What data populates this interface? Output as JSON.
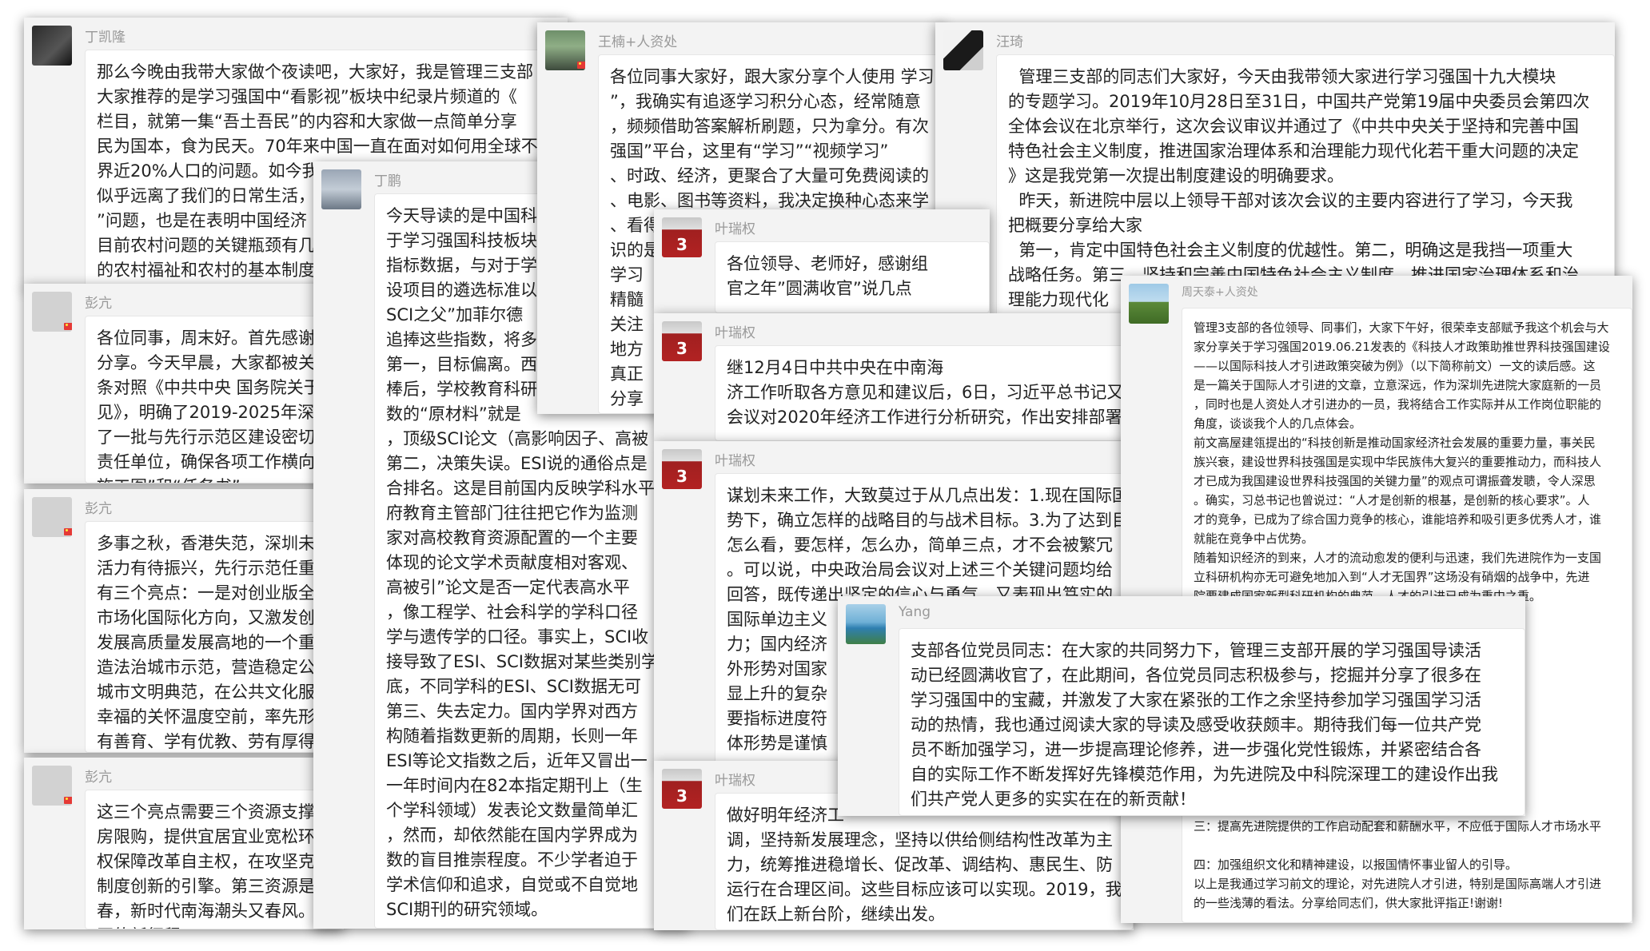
{
  "cards": [
    {
      "nick": "丁凯隆",
      "text": "那么今晚由我带大家做个夜读吧，大家好，我是管理三支部\n大家推荐的是学习强国中“看影视”板块中纪录片频道的《\n栏目，就第一集“吾土吾民”的内容和大家做一点简单分享\n民为国本，食为民天。70年来中国一直在面对如何用全球不\n界近20%人口的问题。如今我\n似乎远离了我们的日常生活，\n”问题，也是在表明中国经济\n目前农村问题的关键瓶颈有几\n的农村福祉和农村的基本制度"
    },
    {
      "nick": "彭亢",
      "text": "各位同事，周末好。首先感谢\n分享。今天早晨，大家都被关\n条对照《中共中央 国务院关于\n见》，明确了2019-2025年深\n了一批与先行示范区建设密切\n责任单位，确保各项工作横向\n施工图”和“任务书”。"
    },
    {
      "nick": "彭亢",
      "text": "多事之秋，香港失范，深圳未\n活力有待振兴，先行示范任重\n有三个亮点：一是对创业版全\n市场化国际化方向，又激发创\n发展高质量发展高地的一个重要抓手\n造法治城市示范，营造稳定公\n城市文明典范，在公共文化服\n幸福的关怀温度空前，率先形\n有善育、学有优教、劳有厚得\n是一座在寒冬也充满激情的有"
    },
    {
      "nick": "彭亢",
      "text": "这三个亮点需要三个资源支撑\n房限购，提供宜居宜业宽松环\n权保障改革自主权，在攻坚克\n制度创新的引擎。第三资源是\n春，新时代南海潮头又春风。\n区的新征程。"
    },
    {
      "nick": "丁鹏",
      "text": "今天导读的是中国科\n于学习强国科技板块\n指标数据，与对于学\n设项目的遴选标准以\nSCI之父”加菲尔德\n追捧这些指数，将多\n第一，目标偏离。西\n棒后，学校教育科研\n数的“原材料”就是\n，顶级SCI论文（高影响因子、高被\n第二，决策失误。ESI说的通俗点是\n合排名。这是目前国内反映学科水平\n府教育主管部门往往把它作为监测\n家对高校教育资源配置的一个主要\n体现的论文学术贡献度相对客观、\n高被引”论文是否一定代表高水平\n，像工程学、社会科学的学科口径\n学与遗传学的口径。事实上，SCI收\n接导致了ESI、SCI数据对某些类别学\n底，不同学科的ESI、SCI数据无可\n第三、失去定力。国内学界对西方\n构随着指数更新的周期，长则一年\nESI等论文指数之后，近年又冒出一\n一年时间内在82本指定期刊上（生\n个学科领域）发表论文数量简单汇\n，然而，却依然能在国内学界成为\n数的盲目推崇程度。不少学者迫于\n学术信仰和追求，自觉或不自觉地\nSCI期刊的研究领域。"
    },
    {
      "nick": "王楠+人资处",
      "text": "各位同事大家好，跟大家分享个人使用 学习\n”，我确实有追逐学习积分心态，经常随意\n，频频借助答案解析刷题，只为拿分。有次\n强国”平台，这里有“学习”“视频学习”\n、时政、经济，更聚合了大量可免费阅读的\n、电影、图书等资料，我决定换种心态来学\n、看得\n识的是\n学习\n精髓\n关注\n地方\n真正\n分享"
    },
    {
      "nick": "汪琦",
      "text": "  管理三支部的同志们大家好，今天由我带领大家进行学习强国十九大模块\n的专题学习。2019年10月28日至31日，中国共产党第19届中央委员会第四次\n全体会议在北京举行，这次会议审议并通过了《中共中央关于坚持和完善中国\n特色社会主义制度，推进国家治理体系和治理能力现代化若干重大问题的决定\n》这是我党第一次提出制度建设的明确要求。\n  昨天，新进院中层以上领导干部对该次会议的主要内容进行了学习，今天我\n把概要分享给大家\n  第一，肯定中国特色社会主义制度的优越性。第二，明确这是我挡一项重大\n战略任务。第三，坚持和完善中国特色社会主义制度，推进国家治理体系和治\n理能力现代化\n加成熟更加定型\n现代化，到新中"
    },
    {
      "nick": "叶瑞权",
      "text": "各位领导、老师好，感谢组\n官之年”圆满收官”说几点"
    },
    {
      "nick": "叶瑞权",
      "text": "继12月4日中共中央在中南海\n济工作听取各方意见和建议后，6日，习近平总书记又\n会议对2020年经济工作进行分析研究，作出安排部署"
    },
    {
      "nick": "叶瑞权",
      "text": "谋划未来工作，大致莫过于从几点出发：1.现在国际国\n势下，确立怎样的战略目的与战术目标。3.为了达到目\n怎么看，要怎样，怎么办，简单三点，才不会被繁冗\n。可以说，中央政治局会议对上述三个关键问题均给\n回答，既传递出坚定的信心与勇气，又表现出笃实的\n国际单边主义\n力；国内经济\n外形势对国家\n显上升的复杂\n要指标进度符\n体形势是谨慎"
    },
    {
      "nick": "叶瑞权",
      "text": "做好明年经济工\n调，坚持新发展理念，坚持以供给侧结构性改革为主\n力，统筹推进稳增长、促改革、调结构、惠民生、防\n运行在合理区间。这些目标应该可以实现。2019，我\n们在跃上新台阶，继续出发。"
    },
    {
      "nick": "周天泰+人资处",
      "text": "管理3支部的各位领导、同事们，大家下午好，很荣幸支部赋予我这个机会与大\n家分享关于学习强国2019.06.21发表的《科技人才政策助推世界科技强国建设\n——以国际科技人才引进政策突破为例》（以下简称前文）一文的读后感。这\n是一篇关于国际人才引进的文章，立意深远，作为深圳先进院大家庭新的一员\n，同时也是人资处人才引进办的一员，我将结合工作实际并从工作岗位职能的\n角度，谈谈我个人的几点体会。\n前文高屋建瓴提出的“科技创新是推动国家经济社会发展的重要力量，事关民\n族兴衰，建设世界科技强国是实现中华民族伟大复兴的重要推动力，而科技人\n才已成为我国建设世界科技强国的关键力量”的观点可谓振聋发聩，令人深思\n。确实，习总书记也曾说过：“人才是创新的根基，是创新的核心要求”。人\n才的竞争，已成为了综合国力竞争的核心，谁能培养和吸引更多优秀人才，谁\n就能在竞争中占优势。\n随着知识经济的到来，人才的流动愈发的便利与迅速，我们先进院作为一支国\n立科研机构亦无可避免地加入到“人才无国界”这场没有硝烟的战争中，先进\n院要建成国家新型科研机构的典范，人才的引进已成为重中之重。\n                                              “人才强院”理\n                                              牵头组建深圳市\n                                              度发展的现状和\n                                              段：由过去资源\n                                              青年海归为人才\n\n                                              进院发展战略对\n                                              攻策的专门研究\n\n                                              人才引进的前置\n                                              系到人力资本投\n三：提高先进院提供的工作启动配套和薪酬水平，不应低于国际人才市场水平\n\n四：加强组织文化和精神建设，以报国情怀事业留人的引导。\n以上是我通过学习前文的理论，对先进院人才引进，特别是国际高端人才引进\n的一些浅薄的看法。分享给同志们，供大家批评指正!谢谢!"
    },
    {
      "nick": "Yang",
      "text": "支部各位党员同志：在大家的共同努力下，管理三支部开展的学习强国导读活\n动已经圆满收官了，在此期间，各位党员同志积极参与，挖掘并分享了很多在\n学习强国中的宝藏，并激发了大家在紧张的工作之余坚持参加学习强国学习活\n动的热情，我也通过阅读大家的导读及感受收获颇丰。期待我们每一位共产党\n员不断加强学习，进一步提高理论修养，进一步强化党性锻炼，并紧密结合各\n自的实际工作不断发挥好先锋模范作用，为先进院及中科院深理工的建设作出我\n们共产党人更多的实实在在的新贡献！"
    }
  ]
}
